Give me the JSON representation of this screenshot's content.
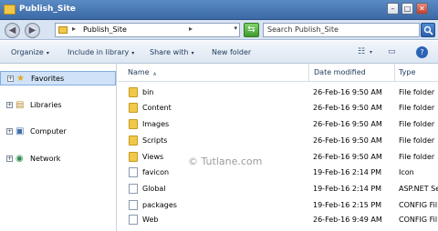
{
  "window": {
    "title": "Publish_Site",
    "minimize": "–",
    "maximize": "□",
    "close": "✕"
  },
  "address": {
    "back": "◀",
    "forward": "▶",
    "separator": "▸",
    "path": "Publish_Site",
    "chevron": "▸",
    "dropdown": "▾",
    "refresh": "⇆",
    "search_text": "Search Publish_Site"
  },
  "toolbar": {
    "organize": "Organize",
    "include_in_library": "Include in library",
    "share_with": "Share with",
    "new_folder": "New folder",
    "dropdown_arrow": "▾",
    "view_icon": "☷",
    "pane_icon": "▭",
    "help_icon": "?"
  },
  "nav": {
    "expander": "+",
    "items": [
      {
        "label": "Favorites",
        "icon": "★",
        "selected": true
      },
      {
        "label": "Libraries",
        "icon": "▤",
        "selected": false
      },
      {
        "label": "Computer",
        "icon": "▣",
        "selected": false
      },
      {
        "label": "Network",
        "icon": "◉",
        "selected": false
      }
    ]
  },
  "columns": {
    "name": "Name",
    "date_modified": "Date modified",
    "type": "Type",
    "sort_caret": "▲"
  },
  "files": [
    {
      "name": "bin",
      "date": "26-Feb-16 9:50 AM",
      "type": "File folder",
      "kind": "folder"
    },
    {
      "name": "Content",
      "date": "26-Feb-16 9:50 AM",
      "type": "File folder",
      "kind": "folder"
    },
    {
      "name": "Images",
      "date": "26-Feb-16 9:50 AM",
      "type": "File folder",
      "kind": "folder"
    },
    {
      "name": "Scripts",
      "date": "26-Feb-16 9:50 AM",
      "type": "File folder",
      "kind": "folder"
    },
    {
      "name": "Views",
      "date": "26-Feb-16 9:50 AM",
      "type": "File folder",
      "kind": "folder"
    },
    {
      "name": "favicon",
      "date": "19-Feb-16 2:14 PM",
      "type": "Icon",
      "kind": "icon"
    },
    {
      "name": "Global",
      "date": "19-Feb-16 2:14 PM",
      "type": "ASP.NET Se",
      "kind": "asax"
    },
    {
      "name": "packages",
      "date": "19-Feb-16 2:15 PM",
      "type": "CONFIG Fil",
      "kind": "config"
    },
    {
      "name": "Web",
      "date": "26-Feb-16 9:49 AM",
      "type": "CONFIG Fil",
      "kind": "config"
    }
  ],
  "watermark": "© Tutlane.com",
  "colors": {
    "titlebar": "#3b6aa6",
    "folder": "#f2c84a",
    "selection": "#cfe2f7"
  }
}
